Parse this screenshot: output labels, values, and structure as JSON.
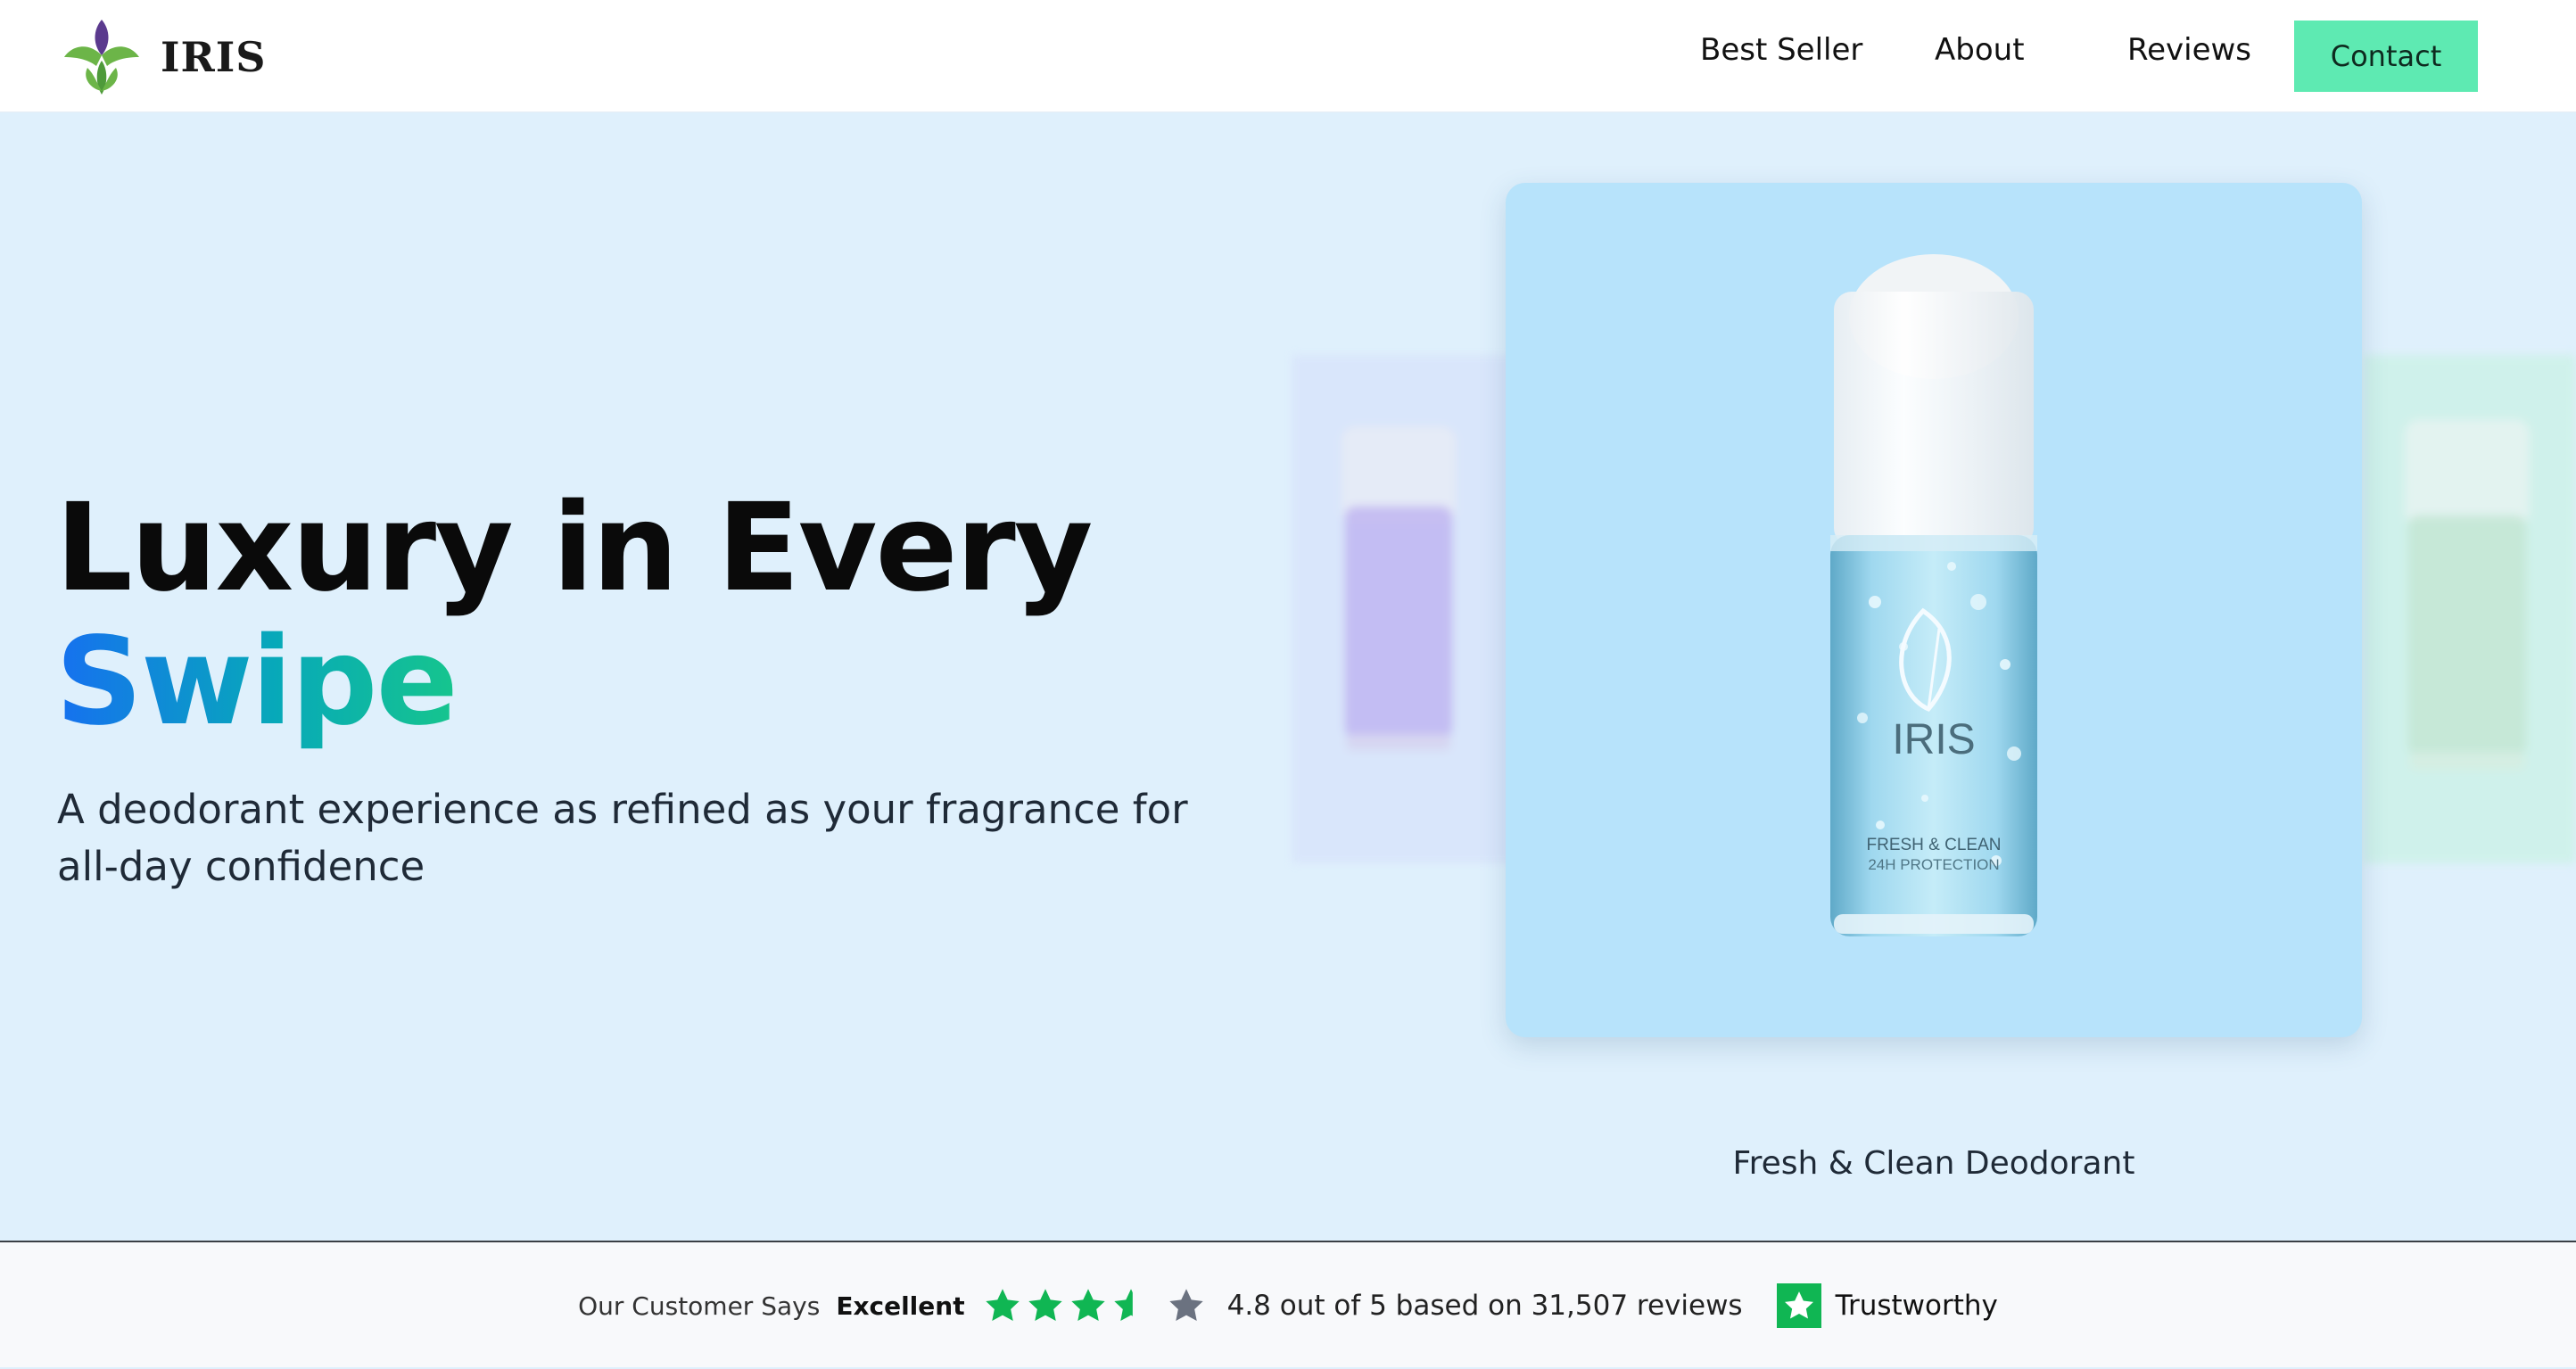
{
  "brand": {
    "name": "IRIS",
    "colors": {
      "purple": "#5b3a8e",
      "green": "#6cb548"
    }
  },
  "nav": {
    "items": [
      {
        "label": "Best Seller"
      },
      {
        "label": "About"
      },
      {
        "label": "Reviews"
      }
    ],
    "contact_label": "Contact",
    "contact_color": "#5eeab2"
  },
  "hero": {
    "title_line1": "Luxury in Every",
    "title_accent": "Swipe",
    "subtitle": "A deodorant experience as refined as your fragrance for all-day confidence",
    "accent_gradient": [
      "#1670f0",
      "#07a9b9",
      "#16c58d"
    ]
  },
  "carousel": {
    "current_product": {
      "name": "Fresh & Clean Deodorant",
      "bottle_brand": "IRIS",
      "bottle_line1": "FRESH & CLEAN",
      "bottle_line2": "24H PROTECTION",
      "card_color": "#b7e3fb"
    },
    "previous_product_color": "#b9a8ee",
    "next_product_color": "#bfe6cc"
  },
  "trust_bar": {
    "says_label": "Our Customer Says",
    "rating_word": "Excellent",
    "stars_filled": 3.5,
    "stars_total": 4,
    "rating_text": "4.8 out of 5 based on 31,507 reviews",
    "trust_label": "Trustworthy",
    "star_color": "#10b653",
    "empty_star_color": "#6b7280"
  }
}
